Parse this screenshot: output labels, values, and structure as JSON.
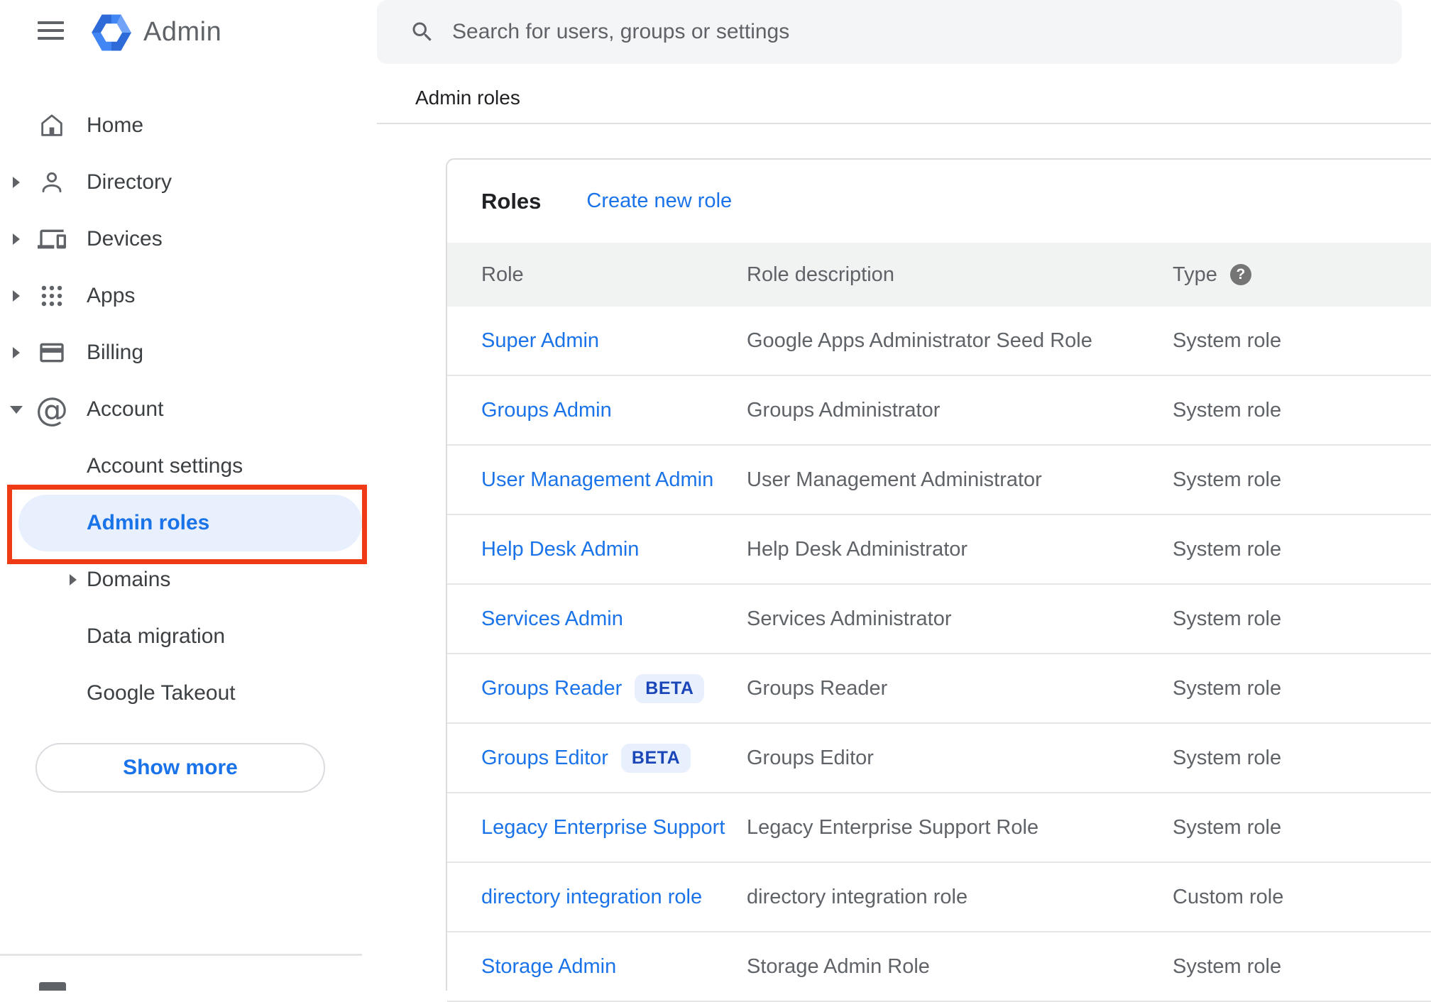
{
  "app": {
    "name": "Admin"
  },
  "header": {
    "search_placeholder": "Search for users, groups or settings",
    "page_title": "Admin roles"
  },
  "sidebar": {
    "items": [
      {
        "label": "Home"
      },
      {
        "label": "Directory"
      },
      {
        "label": "Devices"
      },
      {
        "label": "Apps"
      },
      {
        "label": "Billing"
      },
      {
        "label": "Account"
      },
      {
        "label": "Account settings"
      },
      {
        "label": "Admin roles"
      },
      {
        "label": "Domains"
      },
      {
        "label": "Data migration"
      },
      {
        "label": "Google Takeout"
      }
    ],
    "show_more": "Show more"
  },
  "roles": {
    "title": "Roles",
    "create_link": "Create new role",
    "beta_label": "BETA",
    "help_glyph": "?",
    "columns": [
      "Role",
      "Role description",
      "Type"
    ],
    "rows": [
      {
        "role": "Super Admin",
        "description": "Google Apps Administrator Seed Role",
        "type": "System role"
      },
      {
        "role": "Groups Admin",
        "description": "Groups Administrator",
        "type": "System role"
      },
      {
        "role": "User Management Admin",
        "description": "User Management Administrator",
        "type": "System role"
      },
      {
        "role": "Help Desk Admin",
        "description": "Help Desk Administrator",
        "type": "System role"
      },
      {
        "role": "Services Admin",
        "description": "Services Administrator",
        "type": "System role"
      },
      {
        "role": "Groups Reader",
        "description": "Groups Reader",
        "type": "System role"
      },
      {
        "role": "Groups Editor",
        "description": "Groups Editor",
        "type": "System role"
      },
      {
        "role": "Legacy Enterprise Support",
        "description": "Legacy Enterprise Support Role",
        "type": "System role"
      },
      {
        "role": "directory integration role",
        "description": "directory integration role",
        "type": "Custom role"
      },
      {
        "role": "Storage Admin",
        "description": "Storage Admin Role",
        "type": "System role"
      }
    ]
  },
  "colors": {
    "link_blue": "#1a73e8",
    "logo_blue": "#4285f4",
    "active_item_bg": "#e8f0fe",
    "annotation_red": "#ee3a15",
    "beta_text": "#1b46b8",
    "icon_gray": "#5f6368"
  }
}
